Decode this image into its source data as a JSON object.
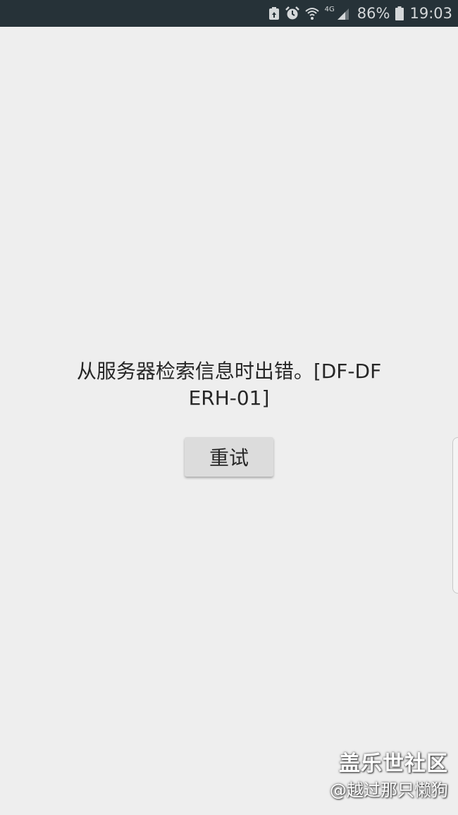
{
  "status_bar": {
    "network_type": "4G",
    "battery_percent": "86%",
    "time": "19:03",
    "icons": [
      "notification-icon",
      "alarm-icon",
      "wifi-icon",
      "signal-icon",
      "battery-icon"
    ],
    "background_color": "#263238"
  },
  "main": {
    "error_message": "从服务器检索信息时出错。[DF-DFERH-01]",
    "retry_label": "重试"
  },
  "watermark": {
    "title": "盖乐世社区",
    "user": "@越过那只懒狗"
  },
  "colors": {
    "page_background": "#eeeeee",
    "button_background": "#dcdcdc",
    "text": "#262626"
  }
}
